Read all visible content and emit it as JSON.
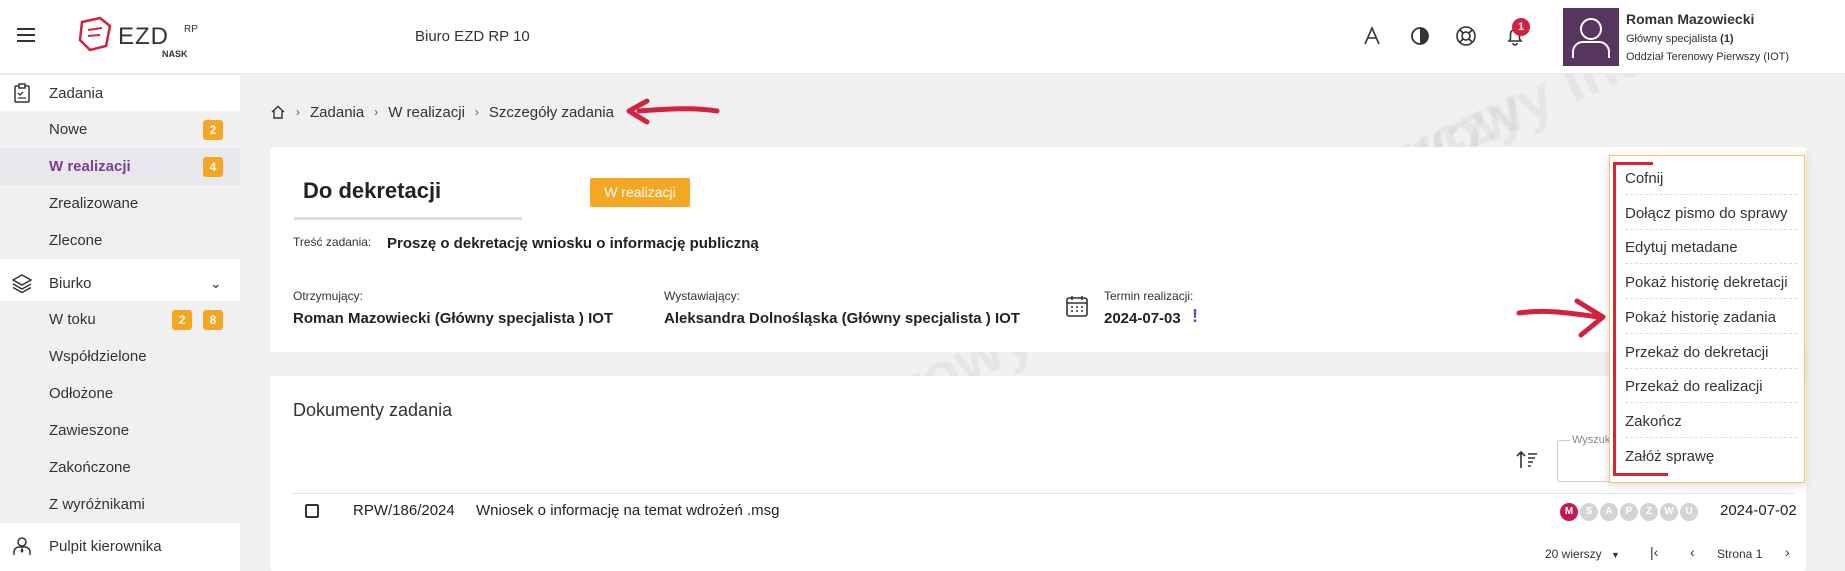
{
  "header": {
    "office_title": "Biuro EZD RP 10",
    "logo_text": "EZD RP",
    "logo_sub": "NASK",
    "notification_count": "1",
    "user": {
      "name": "Roman Mazowiecki",
      "role_prefix": "Główny specjalista ",
      "role_count": "(1)",
      "unit": "Oddział Terenowy Pierwszy (IOT)"
    }
  },
  "sidebar": {
    "zadania": {
      "label": "Zadania",
      "items": [
        {
          "label": "Nowe",
          "badge": "2"
        },
        {
          "label": "W realizacji",
          "badge": "4"
        },
        {
          "label": "Zrealizowane"
        },
        {
          "label": "Zlecone"
        }
      ]
    },
    "biurko": {
      "label": "Biurko",
      "items": [
        {
          "label": "W toku",
          "badge1": "2",
          "badge2": "8"
        },
        {
          "label": "Współdzielone"
        },
        {
          "label": "Odłożone"
        },
        {
          "label": "Zawieszone"
        },
        {
          "label": "Zakończone"
        },
        {
          "label": "Z wyróżnikami"
        }
      ]
    },
    "pulpit": {
      "label": "Pulpit kierownika"
    }
  },
  "breadcrumb": [
    "Zadania",
    "W realizacji",
    "Szczegóły zadania"
  ],
  "task": {
    "title": "Do dekretacji",
    "status": "W realizacji",
    "tresc_label": "Treść zadania:",
    "tresc_value": "Proszę o dekretację wniosku o informację publiczną",
    "otrzymujacy_label": "Otrzymujący:",
    "otrzymujacy_value": "Roman Mazowiecki (Główny specjalista ) IOT",
    "wystawiajacy_label": "Wystawiający:",
    "wystawiajacy_value": "Aleksandra Dolnośląska (Główny specjalista ) IOT",
    "termin_label": "Termin realizacji:",
    "termin_value": "2024-07-03",
    "termin_flag": "!"
  },
  "documents": {
    "title": "Dokumenty zadania",
    "search_placeholder": "Wyszuk",
    "rows": [
      {
        "number": "RPW/186/2024",
        "name": "Wniosek o informację na temat wdrożeń .msg",
        "chips": [
          "M",
          "S",
          "A",
          "P",
          "Z",
          "W",
          "U"
        ],
        "date": "2024-07-02"
      }
    ],
    "pager": {
      "rows_label": "20 wierszy",
      "page_label": "Strona 1"
    }
  },
  "menu": {
    "items": [
      "Cofnij",
      "Dołącz pismo do sprawy",
      "Edytuj metadane",
      "Pokaż historię dekretacji",
      "Pokaż historię zadania",
      "Przekaż do dekretacji",
      "Przekaż do realizacji",
      "Zakończ",
      "Załóż sprawę"
    ]
  },
  "watermark": "NASK - Państwowy Instytut Badawczy",
  "colors": {
    "accent": "#7b3f96",
    "badge": "#f5a623",
    "annotation": "#d1233f",
    "avatar": "#56365e"
  }
}
